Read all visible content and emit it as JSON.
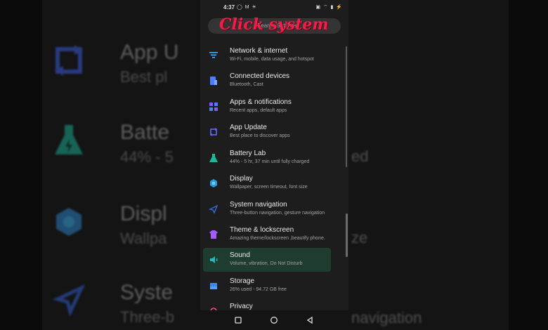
{
  "status": {
    "time": "4:37",
    "left_icons": "◯ M ☀",
    "right_icons": "▣ ⌔ ▮ ⚡"
  },
  "search": {
    "placeholder": "Search Settings"
  },
  "overlay_caption": "Click system",
  "settings": [
    {
      "title": "Network & internet",
      "subtitle": "Wi-Fi, mobile, data usage, and hotspot",
      "icon": "wifi-icon",
      "color": "#3ab0ff"
    },
    {
      "title": "Connected devices",
      "subtitle": "Bluetooth, Cast",
      "icon": "devices-icon",
      "color": "#4a7fff"
    },
    {
      "title": "Apps & notifications",
      "subtitle": "Recent apps, default apps",
      "icon": "apps-icon",
      "color": "#7a5cff"
    },
    {
      "title": "App Update",
      "subtitle": "Best place to discover apps",
      "icon": "update-icon",
      "color": "#5b6bff"
    },
    {
      "title": "Battery Lab",
      "subtitle": "44% - 5 hr, 37 min until fully charged",
      "icon": "battery-flask-icon",
      "color": "#1fb89a"
    },
    {
      "title": "Display",
      "subtitle": "Wallpaper, screen timeout, font size",
      "icon": "display-icon",
      "color": "#2a9bd8"
    },
    {
      "title": "System navigation",
      "subtitle": "Three-button navigation, gesture navigation",
      "icon": "navigation-icon",
      "color": "#3a68d8"
    },
    {
      "title": "Theme & lockscreen",
      "subtitle": "Amazing theme/lockscreen ,beautify phone.",
      "icon": "theme-icon",
      "color": "#a35cff"
    },
    {
      "title": "Sound",
      "subtitle": "Volume, vibration, Do Not Disturb",
      "icon": "sound-icon",
      "color": "#27b6c8"
    },
    {
      "title": "Storage",
      "subtitle": "26% used - 94.72 GB free",
      "icon": "storage-icon",
      "color": "#3a86ff"
    },
    {
      "title": "Privacy",
      "subtitle": "",
      "icon": "privacy-icon",
      "color": "#ff4d7a"
    }
  ],
  "background": {
    "items": [
      {
        "title": "App U",
        "subtitle": "Best pl"
      },
      {
        "title": "Batte",
        "subtitle": "44% - 5"
      },
      {
        "title": "Displ",
        "subtitle": "Wallpa"
      },
      {
        "title": "Syste",
        "subtitle": "Three-b"
      }
    ],
    "right_fragments": [
      "ed",
      "ze",
      "navigation"
    ]
  }
}
